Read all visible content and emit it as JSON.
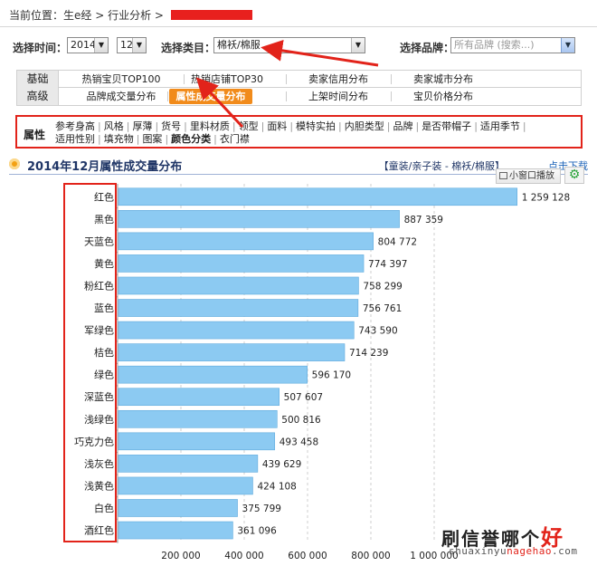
{
  "breadcrumb": {
    "prefix": "当前位置：",
    "items": [
      "生e经",
      "行业分析"
    ],
    "sep": " > ",
    "redacted_color": "#e8201e"
  },
  "filters": {
    "time_label": "选择时间：",
    "year": "2014",
    "month": "12",
    "category_label": "选择类目：",
    "category": "棉袄/棉服",
    "brand_label": "选择品牌：",
    "brand_placeholder": "所有品牌 (搜索...)"
  },
  "nav": {
    "row1_label": "基础",
    "row1_items": [
      "热销宝贝TOP100",
      "热销店铺TOP30",
      "卖家信用分布",
      "卖家城市分布"
    ],
    "row2_label": "高级",
    "row2_items": [
      "品牌成交量分布",
      "属性成交量分布",
      "上架时间分布",
      "宝贝价格分布"
    ],
    "active": "属性成交量分布",
    "active_color": "#f18b1b"
  },
  "attributes": {
    "label": "属性",
    "items": [
      "参考身高",
      "风格",
      "厚薄",
      "货号",
      "里料材质",
      "领型",
      "面料",
      "模特实拍",
      "内胆类型",
      "品牌",
      "是否带帽子",
      "适用季节",
      "适用性别",
      "填充物",
      "图案",
      "颜色分类",
      "衣门襟"
    ],
    "selected": "颜色分类"
  },
  "chart_header": {
    "title": "2014年12月属性成交量分布",
    "category_path": "【童装/亲子装 - 棉袄/棉服】",
    "download": "点击下载",
    "mini_button": "小窗口播放",
    "icons": [
      "window-icon",
      "gear-icon"
    ]
  },
  "chart_data": {
    "type": "bar",
    "orientation": "horizontal",
    "categories": [
      "红色",
      "黑色",
      "天蓝色",
      "黄色",
      "粉红色",
      "蓝色",
      "军绿色",
      "桔色",
      "绿色",
      "深蓝色",
      "浅绿色",
      "巧克力色",
      "浅灰色",
      "浅黄色",
      "白色",
      "酒红色"
    ],
    "values": [
      1259128,
      887359,
      804772,
      774397,
      758299,
      756761,
      743590,
      714239,
      596170,
      507607,
      500816,
      493458,
      439629,
      424108,
      375799,
      361096
    ],
    "value_labels": [
      "1 259 128",
      "887 359",
      "804 772",
      "774 397",
      "758 299",
      "756 761",
      "743 590",
      "714 239",
      "596 170",
      "507 607",
      "500 816",
      "493 458",
      "439 629",
      "424 108",
      "375 799",
      "361 096"
    ],
    "xticks": [
      200000,
      400000,
      600000,
      800000,
      1000000
    ],
    "xtick_labels": [
      "200 000",
      "400 000",
      "600 000",
      "800 000",
      "1 000 000"
    ],
    "xlim": [
      0,
      1400000
    ],
    "grid": true,
    "bar_color": "#8ccaf2",
    "bar_border": "#5da9dc",
    "title": "",
    "xlabel": "",
    "ylabel": ""
  },
  "watermark": {
    "cn_main": "刷信誉哪个",
    "cn_accent": "好",
    "en_a": "shuaxinyu",
    "en_b": "nagehao",
    "en_c": ".com"
  },
  "annotations": {
    "highlight_color": "#e2231a"
  }
}
